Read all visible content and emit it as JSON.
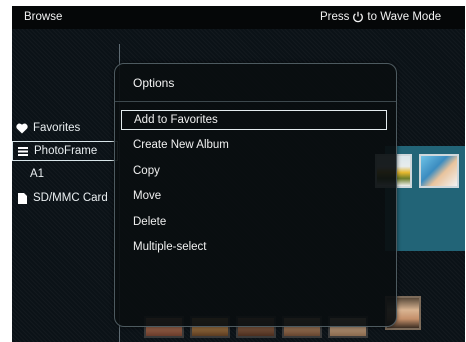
{
  "header": {
    "title": "Browse",
    "hint_prefix": "Press",
    "hint_suffix": "to Wave Mode"
  },
  "sidebar": {
    "items": [
      {
        "label": "Favorites",
        "icon": "heart-icon"
      },
      {
        "label": "PhotoFrame",
        "icon": "list-icon"
      },
      {
        "label": "A1",
        "icon": ""
      },
      {
        "label": "SD/MMC Card",
        "icon": "card-icon"
      }
    ]
  },
  "dialog": {
    "title": "Options",
    "items": [
      {
        "label": "Add to Favorites"
      },
      {
        "label": "Create New Album"
      },
      {
        "label": "Copy"
      },
      {
        "label": "Move"
      },
      {
        "label": "Delete"
      },
      {
        "label": "Multiple-select"
      }
    ]
  },
  "colors": {
    "background": "#0b1217",
    "highlight": "#226477",
    "text": "#f0f0f0"
  }
}
